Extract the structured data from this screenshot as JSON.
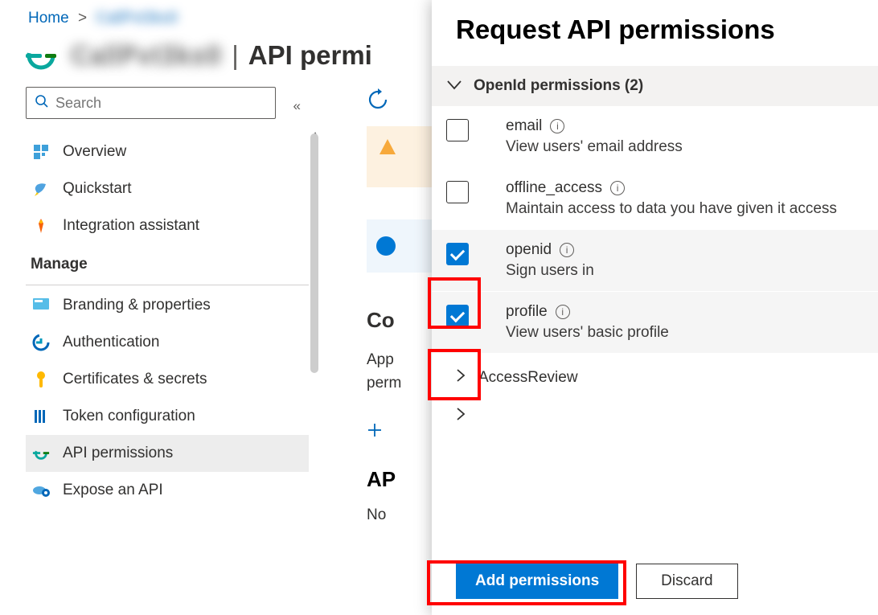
{
  "breadcrumb": {
    "home": "Home",
    "app_name_blur": "CallPvt3ko0"
  },
  "page_title": {
    "app_name_blur": "CallPvt3ko0",
    "suffix": "API permi"
  },
  "search": {
    "placeholder": "Search"
  },
  "nav": {
    "items": [
      {
        "label": "Overview"
      },
      {
        "label": "Quickstart"
      },
      {
        "label": "Integration assistant"
      }
    ],
    "manage_header": "Manage",
    "manage_items": [
      {
        "label": "Branding & properties"
      },
      {
        "label": "Authentication"
      },
      {
        "label": "Certificates & secrets"
      },
      {
        "label": "Token configuration"
      },
      {
        "label": "API permissions"
      },
      {
        "label": "Expose an API"
      }
    ]
  },
  "main": {
    "configured_heading": "Co",
    "configured_desc1": "App",
    "configured_desc2": "perm",
    "add_permission": "Add a permission",
    "api_heading_fragment": "AP",
    "no_display": "No"
  },
  "panel": {
    "title": "Request API permissions",
    "group_label": "OpenId permissions (2)",
    "permissions": [
      {
        "name": "email",
        "desc": "View users' email address",
        "checked": false
      },
      {
        "name": "offline_access",
        "desc": "Maintain access to data you have given it access",
        "checked": false
      },
      {
        "name": "openid",
        "desc": "Sign users in",
        "checked": true
      },
      {
        "name": "profile",
        "desc": "View users' basic profile",
        "checked": true
      }
    ],
    "subgroup_label": "AccessReview",
    "add_button": "Add permissions",
    "discard_button": "Discard"
  }
}
